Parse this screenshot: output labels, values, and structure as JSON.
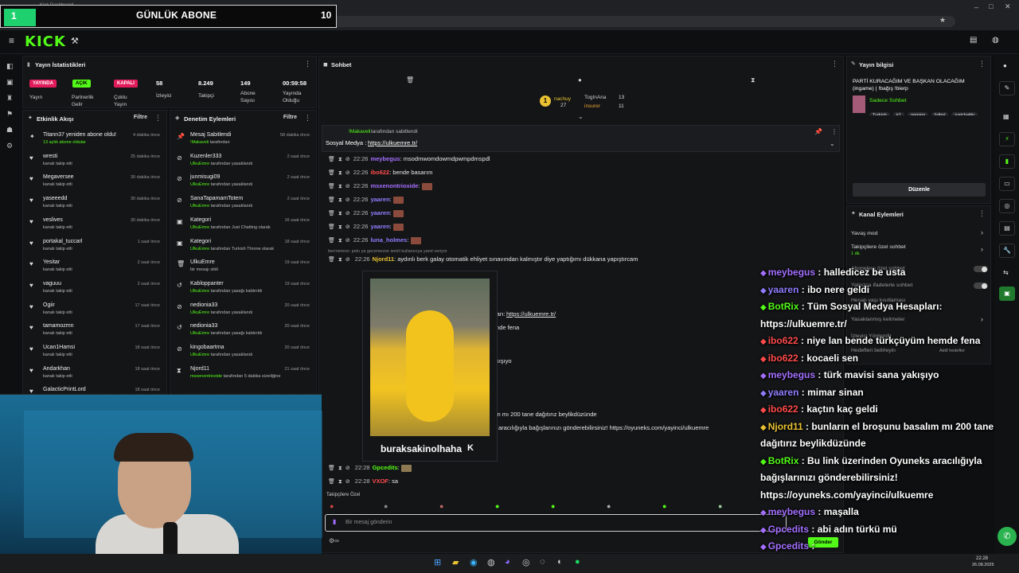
{
  "browser": {
    "tab_title": "Kick Dashboard",
    "url": "https://dashboard.kick.com/stream"
  },
  "overlay_sub": {
    "left_num": "1",
    "title": "GÜNLÜK ABONE",
    "count": "10"
  },
  "stats": {
    "header": "Yayın İstatistikleri",
    "live_badge": "YAYINDA",
    "open_badge": "AÇIK",
    "closed_badge": "KAPALI",
    "stream_label": "Yayın",
    "partner_label": "Partnerlik Gelir",
    "multi_label": "Çoklu Yayın",
    "viewers_value": "58",
    "viewers_label": "İzleyici",
    "followers_value": "8.249",
    "followers_label": "Takipçi",
    "subs_value": "149",
    "subs_label": "Abone Sayısı",
    "duration_value": "00:59:58",
    "duration_label": "Yayında Olduğu"
  },
  "activity": {
    "header": "Etkinlik Akışı",
    "filter": "Filtre",
    "items": [
      {
        "name": "Titann37 yeniden abone oldu!",
        "sub": "13 aylık abone oldular",
        "time": "4 dakika önce"
      },
      {
        "name": "wresti",
        "sub": "kanalı takip etti",
        "time": "25 dakika önce"
      },
      {
        "name": "Megaversee",
        "sub": "kanalı takip etti",
        "time": "30 dakika önce"
      },
      {
        "name": "yaseeedd",
        "sub": "kanalı takip etti",
        "time": "30 dakika önce"
      },
      {
        "name": "veslives",
        "sub": "kanalı takip etti",
        "time": "30 dakika önce"
      },
      {
        "name": "portakal_tuccarl",
        "sub": "kanalı takip etti",
        "time": "1 saat önce"
      },
      {
        "name": "Yesitar",
        "sub": "kanalı takip etti",
        "time": "2 saat önce"
      },
      {
        "name": "vaguuu",
        "sub": "kanalı takip etti",
        "time": "2 saat önce"
      },
      {
        "name": "Ogiir",
        "sub": "kanalı takip etti",
        "time": "17 saat önce"
      },
      {
        "name": "tamamozmn",
        "sub": "kanalı takip etti",
        "time": "17 saat önce"
      },
      {
        "name": "Ucan1Hamsi",
        "sub": "kanalı takip etti",
        "time": "18 saat önce"
      },
      {
        "name": "Andarkhan",
        "sub": "kanalı takip etti",
        "time": "18 saat önce"
      },
      {
        "name": "GalacticPrintLord",
        "sub": "",
        "time": "18 saat önce"
      }
    ]
  },
  "mod": {
    "header": "Denetim Eylemleri",
    "filter": "Filtre",
    "items": [
      {
        "name": "Mesaj Sabitlendi",
        "actor": "!Makaveli",
        "sub": "tarafından",
        "time": "58 dakika önce"
      },
      {
        "name": "Kuzenler333",
        "actor": "UlkuEmre",
        "sub": "tarafından yasaklandı",
        "time": "2 saat önce"
      },
      {
        "name": "junmisugi09",
        "actor": "UlkuEmre",
        "sub": "tarafından yasaklandı",
        "time": "2 saat önce"
      },
      {
        "name": "SanaTapamamTotem",
        "actor": "UlkuEmre",
        "sub": "tarafından yasaklandı",
        "time": "2 saat önce"
      },
      {
        "name": "Kategori",
        "actor": "UlkuEmre",
        "sub": "tarafından Just Chatting olarak",
        "time": "16 saat önce"
      },
      {
        "name": "Kategori",
        "actor": "UlkuEmre",
        "sub": "tarafından Turkish Throne olarak",
        "time": "18 saat önce"
      },
      {
        "name": "UlkuEmre",
        "actor": "",
        "sub": "bir mesajı sildi",
        "time": "19 saat önce"
      },
      {
        "name": "Kabloppanter",
        "actor": "UlkuEmre",
        "sub": "tarafından yasağı kaldırıldı",
        "time": "19 saat önce"
      },
      {
        "name": "nedionia33",
        "actor": "UlkuEmre",
        "sub": "tarafından yasaklandı",
        "time": "20 saat önce"
      },
      {
        "name": "nedionia33",
        "actor": "UlkuEmre",
        "sub": "tarafından yasağı kaldırıldı",
        "time": "20 saat önce"
      },
      {
        "name": "kingobaartma",
        "actor": "UlkuEmre",
        "sub": "tarafından yasaklandı",
        "time": "20 saat önce"
      },
      {
        "name": "Njord11",
        "actor": "msxenontrioxide",
        "sub": "tarafından 5 dakika süreliğine",
        "time": "21 saat önce"
      }
    ]
  },
  "chat": {
    "header": "Sohbet",
    "top_users": [
      {
        "name": "nachuy",
        "value": "27"
      },
      {
        "name": "TogInAna",
        "value": "13"
      },
      {
        "name": "insurer",
        "value": "11"
      }
    ],
    "pinned_by": "!Makaveli",
    "pinned_suffix": "tarafından sabitlendi",
    "pinned_text": "Sosyal Medya :",
    "pinned_link": "https://ulkuemre.tr/",
    "messages": [
      {
        "time": "22:26",
        "user": "meybegus",
        "text": ": msodmwomdowmdpwmpdmspdl",
        "color": "#a370ff"
      },
      {
        "time": "22:26",
        "user": "ibo622",
        "text": ": bende basarım",
        "color": "#ff4b4b"
      },
      {
        "time": "22:26",
        "user": "msxenontrioxide",
        "text": ":",
        "color": "#a370ff"
      },
      {
        "time": "22:26",
        "user": "yaaren",
        "text": ":",
        "color": "#8f7dff"
      },
      {
        "time": "22:26",
        "user": "yaaren",
        "text": ":",
        "color": "#8f7dff"
      },
      {
        "time": "22:26",
        "user": "yaaren",
        "text": ":",
        "color": "#8f7dff"
      },
      {
        "time": "22:26",
        "user": "luna_holmes",
        "text": ":",
        "color": "#8f7dff"
      }
    ],
    "reply_context": "berrnemnn: pekı ya gecemezse ismili kullanıcıya yanıt veriyor",
    "njord_time": "22:26",
    "njord_user": "Njord11",
    "njord_text": ": aydınlı berk galay otomatik ehliyet sınavından kalmıştır diye yaptığımı dükkana yapıştırcam",
    "hidden_fragments": {
      "link": "ları:",
      "link_url": "https://ulkuemre.tr/",
      "f1": "nde fena",
      "f2": "kışıyo",
      "f3": "rn mı 200 tane dağıtırız beylikdüzünde",
      "f4": "aracılığıyla bağışlarınızı gönderebilirsiniz! https://oyuneks.com/yayinci/ulkuemre"
    },
    "gp_time": "22:28",
    "gp_user": "Gpcedits",
    "vx_time": "22:28",
    "vx_user": "VXOF",
    "vx_text": ": sa",
    "emote_name": "buraksakinolhaha",
    "followers_only": "Takipçilere Özel",
    "input_placeholder": "Bir mesaj gönderin",
    "send_label": "Gönder"
  },
  "stream_info": {
    "header": "Yayın bilgisi",
    "title": "PARTİ KURACAĞIM VE BAŞKAN OLACAĞIM (ingame) | !bağış !bierp",
    "mode": "Sadece Sohbet",
    "tags": [
      "Turkish",
      "ir1",
      "gaming",
      "futbol",
      "justchattin"
    ],
    "edit_label": "Düzenle"
  },
  "channel_actions": {
    "header": "Kanal Eylemleri",
    "slow_mode": "Yavaş mod",
    "followers_chat": "Takipçilere özel sohbet",
    "followers_chat_sub": "1 dk.",
    "subs_chat": "Abonelere özel sohbet",
    "emotes_chat": "Yalnızca ifadelerle sohbet",
    "account_age": "Hesap yaşı kısıtlaması",
    "banned_words": "Yasaklanmış kelimeler",
    "viewer_auth": "İzleyici Yönlendir",
    "goals": "Hedefleri belirleyin",
    "goals_sub": "Aktif hedefler"
  },
  "overlay_chat": [
    {
      "user": "meybegus",
      "text": " : halledicez be usta",
      "color": "#a370ff"
    },
    {
      "user": "yaaren",
      "text": " : ibo nere geldi",
      "color": "#8f7dff"
    },
    {
      "user": "BotRix",
      "text": " : Tüm Sosyal Medya Hesapları:",
      "color": "#53fc18"
    },
    {
      "user": "",
      "text": "https://ulkuemre.tr/",
      "color": "#ffffff"
    },
    {
      "user": "ibo622",
      "text": " : niye lan bende türkçüyüm hemde fena",
      "color": "#ff4b4b"
    },
    {
      "user": "ibo622",
      "text": " : kocaeli sen",
      "color": "#ff4b4b"
    },
    {
      "user": "meybegus",
      "text": " : türk mavisi sana yakışıyo",
      "color": "#a370ff"
    },
    {
      "user": "yaaren",
      "text": " : mimar sinan",
      "color": "#8f7dff"
    },
    {
      "user": "ibo622",
      "text": " : kaçtın kaç geldi",
      "color": "#ff4b4b"
    },
    {
      "user": "Njord11",
      "text": " : bunların el broşunu basalım mı 200 tane",
      "color": "#e9c234"
    },
    {
      "user": "",
      "text": "dağıtırız beylikdüzünde",
      "color": "#ffffff"
    },
    {
      "user": "BotRix",
      "text": " : Bu link üzerinden Oyuneks aracılığıyla",
      "color": "#53fc18"
    },
    {
      "user": "",
      "text": "bağışlarınızı gönderebilirsiniz!",
      "color": "#ffffff"
    },
    {
      "user": "",
      "text": "https://oyuneks.com/yayinci/ulkuemre",
      "color": "#ffffff"
    },
    {
      "user": "meybegus",
      "text": " : maşalla",
      "color": "#a370ff"
    },
    {
      "user": "Gpcedits",
      "text": " : abi adın türkü mü",
      "color": "#a370ff"
    },
    {
      "user": "Gpcedits",
      "text": " :",
      "color": "#a370ff"
    },
    {
      "user": "VXOF",
      "text": " : sa",
      "color": "#ff4b4b"
    }
  ],
  "taskbar": {
    "time": "22:28",
    "date": "26.08.2025"
  },
  "colors": {
    "accent": "#53fc18",
    "live": "#e21b5a"
  }
}
